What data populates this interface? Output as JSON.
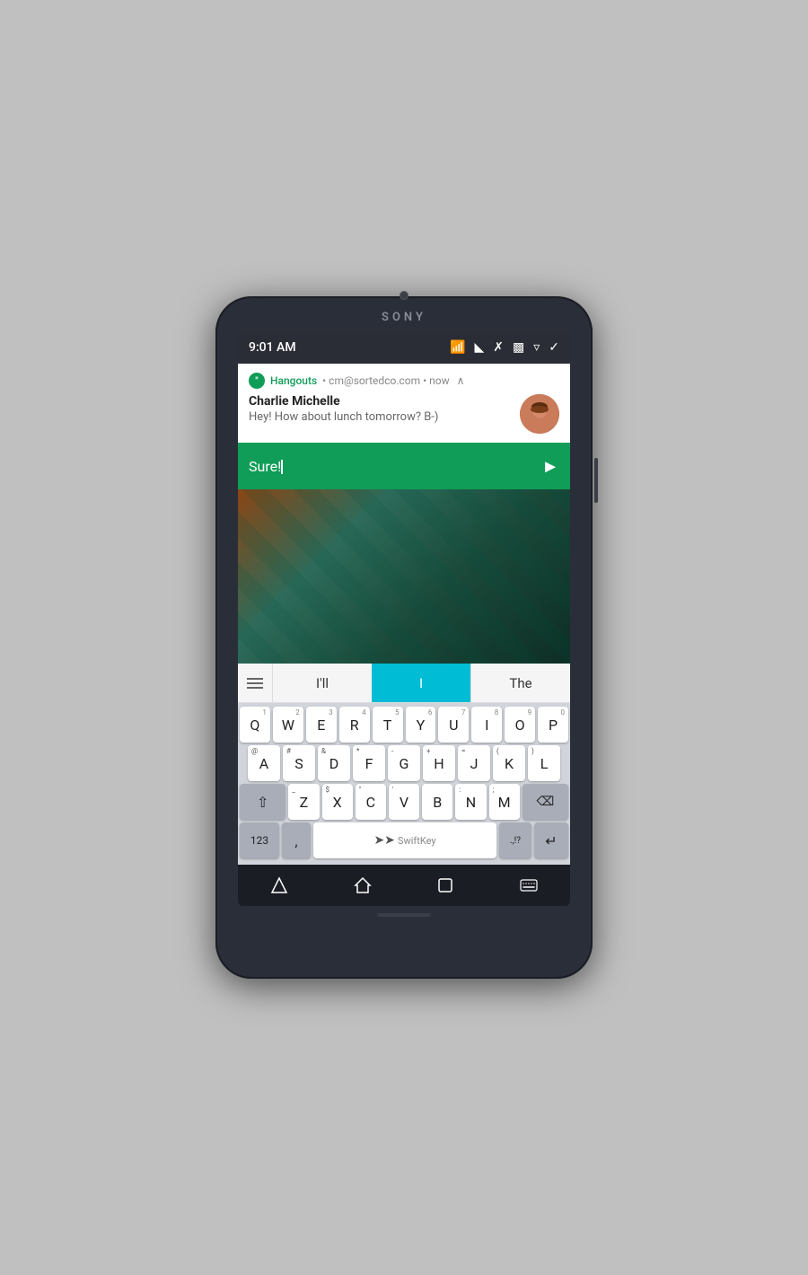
{
  "phone": {
    "brand": "SONY",
    "status_bar": {
      "time": "9:01 AM",
      "icons": [
        "wifi",
        "rotate",
        "bluetooth",
        "cast",
        "flashlight",
        "expand"
      ]
    },
    "notification": {
      "app": "Hangouts",
      "email": "cm@sortedco.com",
      "time_label": "now",
      "sender": "Charlie Michelle",
      "message": "Hey! How about lunch tomorrow? B-)",
      "reply_text": "Sure!"
    },
    "predictive": {
      "menu_icon": "≡",
      "word1": "I'll",
      "word2": "I",
      "word3": "The"
    },
    "keyboard": {
      "rows": [
        [
          "Q",
          "W",
          "E",
          "R",
          "T",
          "Y",
          "U",
          "I",
          "O",
          "P"
        ],
        [
          "A",
          "S",
          "D",
          "F",
          "G",
          "H",
          "J",
          "K",
          "L"
        ],
        [
          "Z",
          "X",
          "C",
          "V",
          "B",
          "N",
          "M"
        ]
      ],
      "numbers": [
        "1",
        "2",
        "3",
        "4",
        "5",
        "6",
        "7",
        "8",
        "9",
        "0"
      ],
      "row2_symbols": [
        "@",
        "#",
        "&",
        "*",
        "-",
        "+",
        "=",
        "(",
        ")",
        null
      ],
      "row3_symbols": [
        null,
        "_",
        "$",
        "\"",
        "'",
        ":",
        ";",
        " /"
      ],
      "special_keys": {
        "shift": "⇧",
        "backspace": "⌫",
        "numbers": "123",
        "comma": ",",
        "space": "SwiftKey",
        "punctuation": ".,!?",
        "enter": "↵"
      }
    },
    "bottom_nav": {
      "back": "▽",
      "home": "⌂",
      "recents": "□",
      "keyboard": "⌨"
    }
  }
}
